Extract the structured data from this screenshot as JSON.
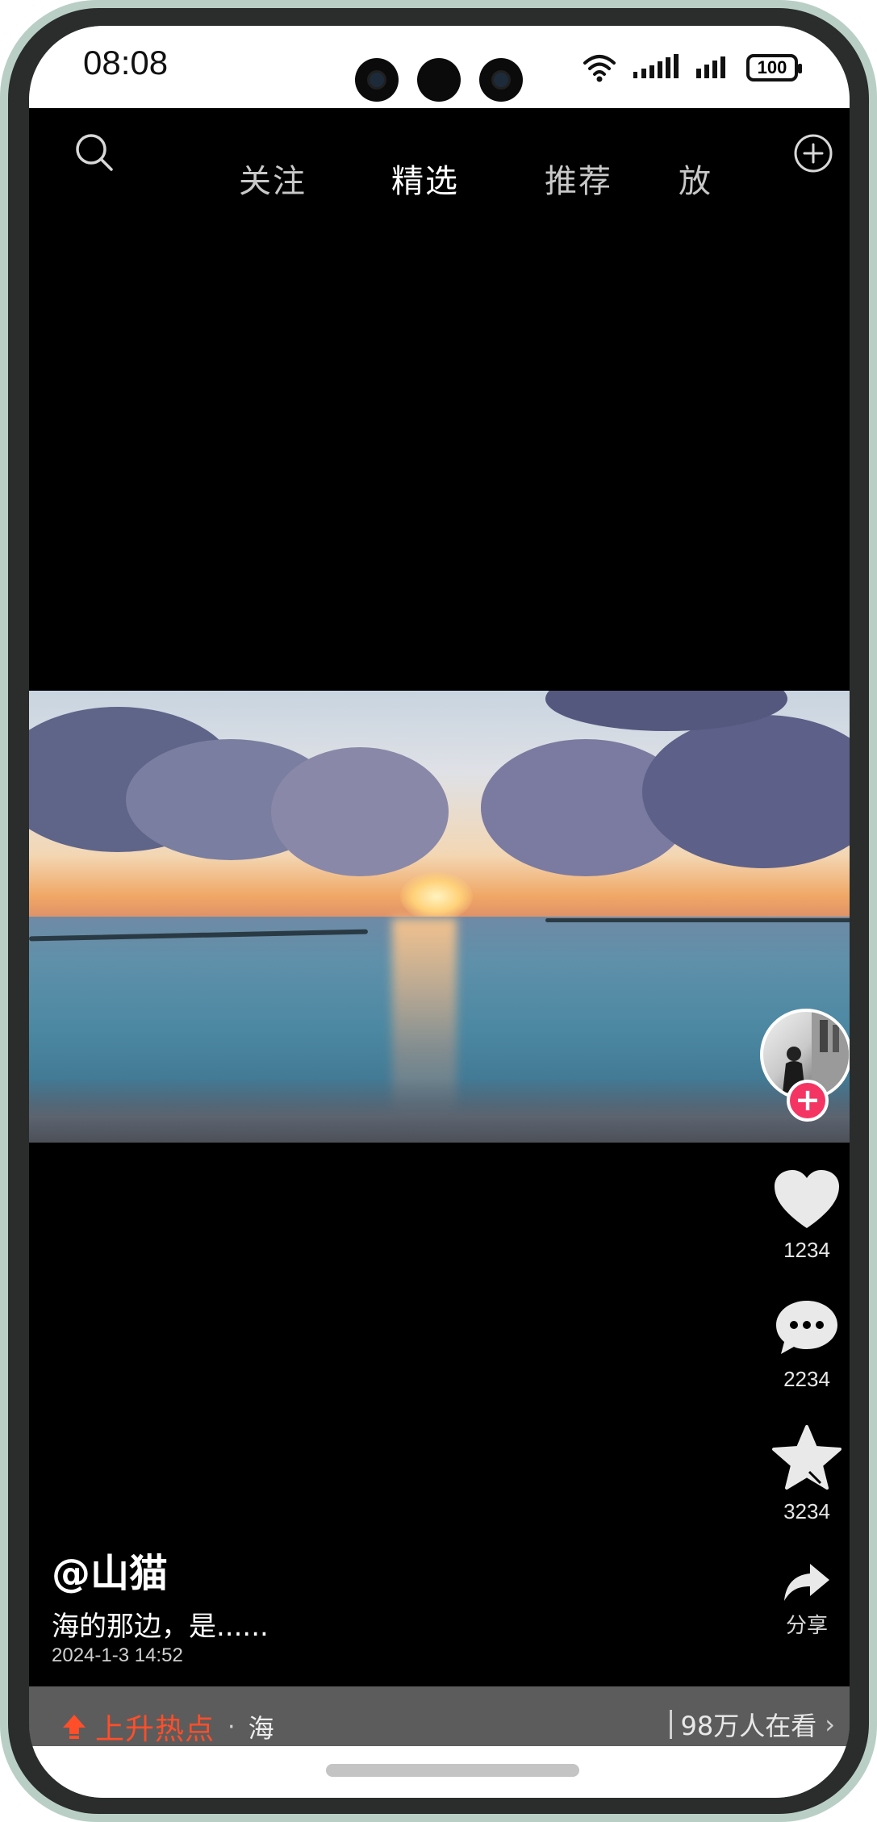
{
  "status_bar": {
    "time": "08:08",
    "battery": "100"
  },
  "nav": {
    "tabs": [
      {
        "label": "关注"
      },
      {
        "label": "精选"
      },
      {
        "label": "推荐"
      },
      {
        "label": "放"
      }
    ],
    "active_tab": "精选",
    "search_icon": "search-icon",
    "add_icon": "plus-circle-icon"
  },
  "video": {
    "scene": "sunset-over-sea"
  },
  "actions": {
    "like_count": "1234",
    "comment_count": "2234",
    "favorite_count": "3234",
    "share_label": "分享",
    "follow_badge": "+"
  },
  "post": {
    "username": "@山猫",
    "caption": "海的那边，是......",
    "datetime": "2024-1-3 14:52"
  },
  "hot_bar": {
    "label": "上升热点",
    "separator": "·",
    "topic": "海",
    "viewers": "98万人在看",
    "chevron": "›"
  },
  "colors": {
    "accent_red": "#f43564",
    "hot_orange": "#ff4e2a",
    "hot_bar_bg": "#5c5c5c"
  }
}
